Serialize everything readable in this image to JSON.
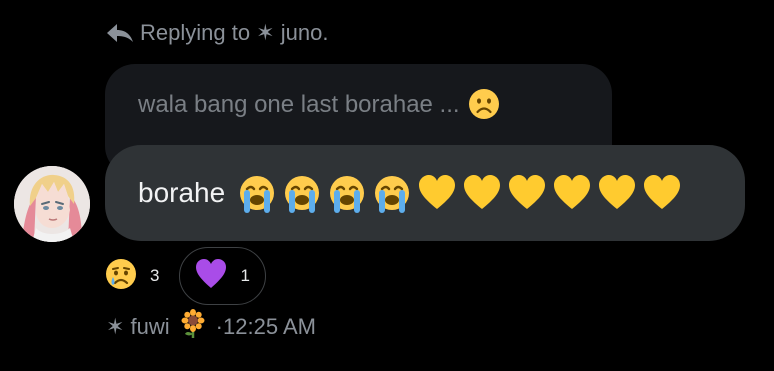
{
  "reply_context": {
    "text": "Replying to ✶ juno.",
    "icon": "reply-arrow-icon"
  },
  "quoted_message": {
    "text": "wala bang one last borahae ...",
    "emoji": "frowning-face"
  },
  "message": {
    "text": "borahe",
    "emojis": [
      "loudly-crying-face",
      "loudly-crying-face",
      "loudly-crying-face",
      "loudly-crying-face",
      "yellow-heart",
      "yellow-heart",
      "yellow-heart",
      "yellow-heart",
      "yellow-heart",
      "yellow-heart"
    ]
  },
  "reactions": [
    {
      "emoji": "crying-face",
      "count": "3",
      "selected": false
    },
    {
      "emoji": "purple-heart",
      "count": "1",
      "selected": true
    }
  ],
  "sender": {
    "name": "✶ fuwi",
    "badge_emoji": "sunflower",
    "timestamp": "·12:25 AM"
  },
  "colors": {
    "background": "#000000",
    "bubble": "#2f3336",
    "quoted_bubble": "#16181c",
    "secondary_text": "#8b9199",
    "yellow_heart": "#ffcb2f",
    "purple_heart": "#a94ce8"
  }
}
